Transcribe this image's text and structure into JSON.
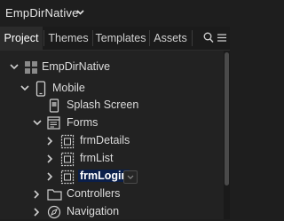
{
  "app": {
    "title": "EmpDirNative"
  },
  "tabs": [
    {
      "label": "Project",
      "active": true
    },
    {
      "label": "Themes",
      "active": false
    },
    {
      "label": "Templates",
      "active": false
    },
    {
      "label": "Assets",
      "active": false
    }
  ],
  "tab_icons": [
    "search-icon",
    "menu-icon"
  ],
  "tree": {
    "root": {
      "label": "EmpDirNative",
      "icon": "grid-icon",
      "expanded": true
    },
    "mobile": {
      "label": "Mobile",
      "icon": "phone-icon",
      "expanded": true
    },
    "splash": {
      "label": "Splash Screen",
      "icon": "splash-screen-icon"
    },
    "forms": {
      "label": "Forms",
      "icon": "forms-icon",
      "expanded": true
    },
    "forms_items": [
      {
        "label": "frmDetails",
        "icon": "form-icon",
        "expanded": false
      },
      {
        "label": "frmList",
        "icon": "form-icon",
        "expanded": false
      },
      {
        "label": "frmLogin",
        "icon": "form-icon",
        "expanded": false,
        "selected": true
      }
    ],
    "controllers": {
      "label": "Controllers",
      "icon": "folder-icon",
      "expanded": false
    },
    "navigation": {
      "label": "Navigation",
      "icon": "compass-icon",
      "expanded": false
    }
  },
  "colors": {
    "background": "#1e1e1e",
    "tree_background": "#222222",
    "selection": "#0b1f4a",
    "text": "#dcdcdc"
  }
}
